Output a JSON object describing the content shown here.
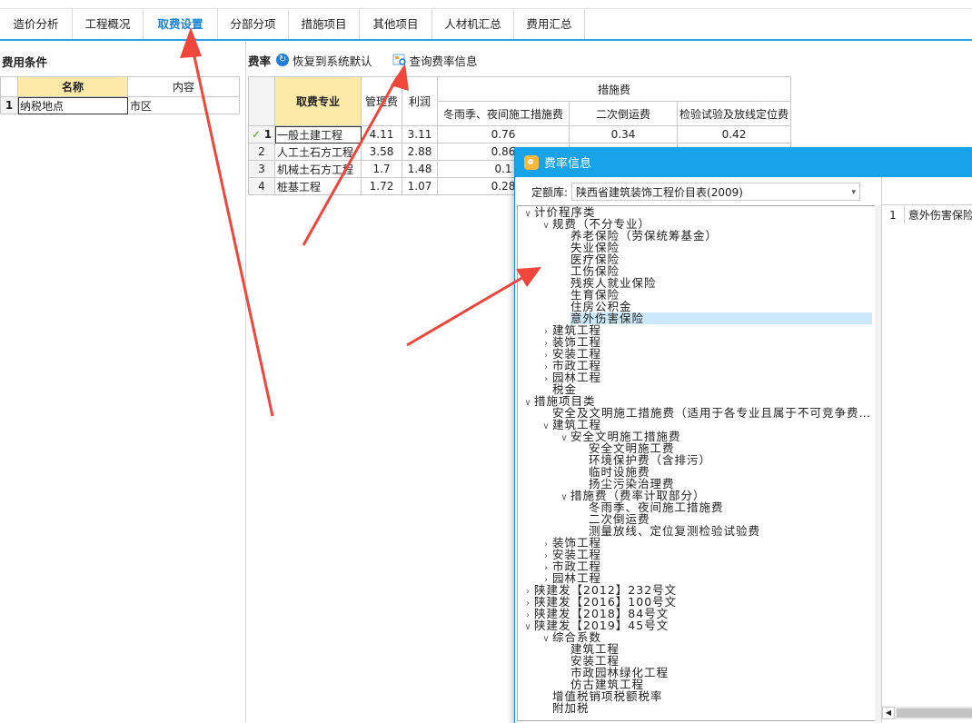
{
  "tabs": [
    "造价分析",
    "工程概况",
    "取费设置",
    "分部分项",
    "措施项目",
    "其他项目",
    "人材机汇总",
    "费用汇总"
  ],
  "active_tab": 2,
  "left": {
    "title": "费用条件",
    "col_name": "名称",
    "col_content": "内容",
    "rows": [
      {
        "num": "1",
        "name": "纳税地点",
        "value": "市区"
      }
    ]
  },
  "rate": {
    "label": "费率",
    "restore": "恢复到系统默认",
    "query": "查询费率信息",
    "headers": {
      "major": "取费专业",
      "mgmt": "管理费",
      "profit": "利润",
      "measure": "措施费",
      "m1": "冬雨季、夜间施工措施费",
      "m2": "二次倒运费",
      "m3": "检验试验及放线定位费"
    },
    "rows": [
      {
        "num": "1",
        "major": "一般土建工程",
        "mgmt": "4.11",
        "profit": "3.11",
        "m1": "0.76",
        "m2": "0.34",
        "m3": "0.42"
      },
      {
        "num": "2",
        "major": "人工土石方工程",
        "mgmt": "3.58",
        "profit": "2.88",
        "m1": "0.86",
        "m2": "",
        "m3": ""
      },
      {
        "num": "3",
        "major": "机械土石方工程",
        "mgmt": "1.7",
        "profit": "1.48",
        "m1": "0.1",
        "m2": "",
        "m3": ""
      },
      {
        "num": "4",
        "major": "桩基工程",
        "mgmt": "1.72",
        "profit": "1.07",
        "m1": "0.28",
        "m2": "",
        "m3": ""
      }
    ]
  },
  "dialog": {
    "title": "费率信息",
    "ku_label": "定额库:",
    "ku_value": "陕西省建筑装饰工程价目表(2009)",
    "tree": [
      {
        "t": "计价程序类",
        "l": 0,
        "e": "open"
      },
      {
        "t": "规费（不分专业）",
        "l": 1,
        "e": "open"
      },
      {
        "t": "养老保险（劳保统筹基金）",
        "l": 2,
        "e": ""
      },
      {
        "t": "失业保险",
        "l": 2,
        "e": ""
      },
      {
        "t": "医疗保险",
        "l": 2,
        "e": ""
      },
      {
        "t": "工伤保险",
        "l": 2,
        "e": ""
      },
      {
        "t": "残疾人就业保险",
        "l": 2,
        "e": ""
      },
      {
        "t": "生育保险",
        "l": 2,
        "e": ""
      },
      {
        "t": "住房公积金",
        "l": 2,
        "e": ""
      },
      {
        "t": "意外伤害保险",
        "l": 2,
        "e": "",
        "sel": true
      },
      {
        "t": "建筑工程",
        "l": 1,
        "e": "closed"
      },
      {
        "t": "装饰工程",
        "l": 1,
        "e": "closed"
      },
      {
        "t": "安装工程",
        "l": 1,
        "e": "closed"
      },
      {
        "t": "市政工程",
        "l": 1,
        "e": "closed"
      },
      {
        "t": "园林工程",
        "l": 1,
        "e": "closed"
      },
      {
        "t": "税金",
        "l": 1,
        "e": ""
      },
      {
        "t": "措施项目类",
        "l": 0,
        "e": "open"
      },
      {
        "t": "安全及文明施工措施费（适用于各专业且属于不可竞争费…",
        "l": 1,
        "e": ""
      },
      {
        "t": "建筑工程",
        "l": 1,
        "e": "open"
      },
      {
        "t": "安全文明施工措施费",
        "l": 2,
        "e": "open"
      },
      {
        "t": "安全文明施工费",
        "l": 3,
        "e": ""
      },
      {
        "t": "环境保护费（含排污）",
        "l": 3,
        "e": ""
      },
      {
        "t": "临时设施费",
        "l": 3,
        "e": ""
      },
      {
        "t": "扬尘污染治理费",
        "l": 3,
        "e": ""
      },
      {
        "t": "措施费（费率计取部分）",
        "l": 2,
        "e": "open"
      },
      {
        "t": "冬雨季、夜间施工措施费",
        "l": 3,
        "e": ""
      },
      {
        "t": "二次倒运费",
        "l": 3,
        "e": ""
      },
      {
        "t": "测量放线、定位复测检验试验费",
        "l": 3,
        "e": ""
      },
      {
        "t": "装饰工程",
        "l": 1,
        "e": "closed"
      },
      {
        "t": "安装工程",
        "l": 1,
        "e": "closed"
      },
      {
        "t": "市政工程",
        "l": 1,
        "e": "closed"
      },
      {
        "t": "园林工程",
        "l": 1,
        "e": "closed"
      },
      {
        "t": "陕建发【2012】232号文",
        "l": 0,
        "e": "closed"
      },
      {
        "t": "陕建发【2016】100号文",
        "l": 0,
        "e": "closed"
      },
      {
        "t": "陕建发【2018】84号文",
        "l": 0,
        "e": "closed"
      },
      {
        "t": "陕建发【2019】45号文",
        "l": 0,
        "e": "open"
      },
      {
        "t": "综合系数",
        "l": 1,
        "e": "open"
      },
      {
        "t": "建筑工程",
        "l": 2,
        "e": ""
      },
      {
        "t": "安装工程",
        "l": 2,
        "e": ""
      },
      {
        "t": "市政园林绿化工程",
        "l": 2,
        "e": ""
      },
      {
        "t": "仿古建筑工程",
        "l": 2,
        "e": ""
      },
      {
        "t": "增值税销项税额税率",
        "l": 1,
        "e": ""
      },
      {
        "t": "附加税",
        "l": 1,
        "e": ""
      }
    ],
    "side_row": {
      "num": "1",
      "text": "意外伤害保险"
    }
  },
  "colors": {
    "accent": "#18a3e8",
    "tab_active": "#1a86d9",
    "header_hl": "#fde9a8",
    "arrow": "#f0463c"
  }
}
